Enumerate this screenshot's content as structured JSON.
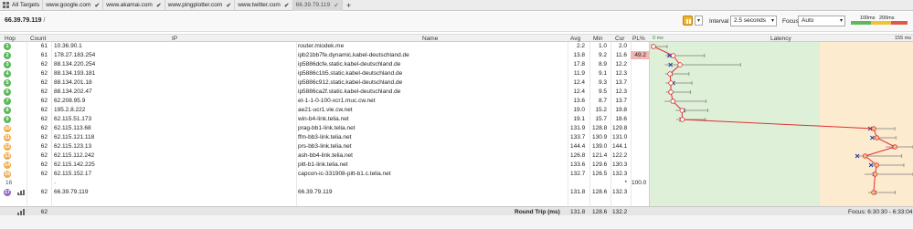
{
  "tabs": [
    {
      "label": "All Targets"
    },
    {
      "label": "www.google.com"
    },
    {
      "label": "www.akamai.com"
    },
    {
      "label": "www.pingplotter.com"
    },
    {
      "label": "www.twitter.com"
    },
    {
      "label": "66.39.79.119"
    }
  ],
  "add_tab_symbol": "+",
  "toolbar": {
    "target": "66.39.79.119",
    "suffix": " /",
    "menu_caret": "▾",
    "interval_label": "Interval",
    "interval_value": "2.5 seconds",
    "focus_label": "Focus",
    "focus_value": "Auto",
    "legend_100": "100ms",
    "legend_200": "200ms"
  },
  "columns": {
    "hop": "Hop",
    "count": "Count",
    "ip": "IP",
    "name": "Name",
    "avg": "Avg",
    "min": "Min",
    "cur": "Cur",
    "pl": "PL%",
    "latency": "Latency"
  },
  "graph": {
    "min_label": "0 ms",
    "max_label": "155 ms",
    "max_ms": 155,
    "colors": {
      "green": "#5cb85c",
      "yellow": "#f0ad4e",
      "line": "#e03030",
      "marker": "#1f3fb0"
    }
  },
  "hops": [
    {
      "hop": "1",
      "count": "61",
      "ip": "10.36.90.1",
      "name": "router.miodek.me",
      "avg": "2.2",
      "min": "1.0",
      "cur": "2.0",
      "pl": "",
      "status": "green"
    },
    {
      "hop": "2",
      "count": "61",
      "ip": "178.27.183.254",
      "name": "ipb21bb7fe.dynamic.kabel-deutschland.de",
      "avg": "13.8",
      "min": "9.2",
      "cur": "11.6",
      "pl": "49.2",
      "status": "green"
    },
    {
      "hop": "3",
      "count": "62",
      "ip": "88.134.220.254",
      "name": "ip5886dcfe.static.kabel-deutschland.de",
      "avg": "17.8",
      "min": "8.9",
      "cur": "12.2",
      "pl": "",
      "status": "green"
    },
    {
      "hop": "4",
      "count": "62",
      "ip": "88.134.193.181",
      "name": "ip5886c1b5.static.kabel-deutschland.de",
      "avg": "11.9",
      "min": "9.1",
      "cur": "12.3",
      "pl": "",
      "status": "green"
    },
    {
      "hop": "5",
      "count": "62",
      "ip": "88.134.201.18",
      "name": "ip5886c912.static.kabel-deutschland.de",
      "avg": "12.4",
      "min": "9.3",
      "cur": "13.7",
      "pl": "",
      "status": "green"
    },
    {
      "hop": "6",
      "count": "62",
      "ip": "88.134.202.47",
      "name": "ip5886ca2f.static.kabel-deutschland.de",
      "avg": "12.4",
      "min": "9.5",
      "cur": "12.3",
      "pl": "",
      "status": "green"
    },
    {
      "hop": "7",
      "count": "62",
      "ip": "62.208.95.9",
      "name": "et-1-1-0-100-xcr1.muc.cw.net",
      "avg": "13.6",
      "min": "8.7",
      "cur": "13.7",
      "pl": "",
      "status": "green"
    },
    {
      "hop": "8",
      "count": "62",
      "ip": "195.2.8.222",
      "name": "ae21-ucr1.vie.cw.net",
      "avg": "19.0",
      "min": "15.2",
      "cur": "19.8",
      "pl": "",
      "status": "green"
    },
    {
      "hop": "9",
      "count": "62",
      "ip": "62.115.51.173",
      "name": "win-b4-link.telia.net",
      "avg": "19.1",
      "min": "15.7",
      "cur": "18.6",
      "pl": "",
      "status": "green"
    },
    {
      "hop": "10",
      "count": "62",
      "ip": "62.115.113.68",
      "name": "prag-bb1-link.telia.net",
      "avg": "131.9",
      "min": "128.8",
      "cur": "129.8",
      "pl": "",
      "status": "yellow"
    },
    {
      "hop": "11",
      "count": "62",
      "ip": "62.115.121.118",
      "name": "ffm-bb3-link.telia.net",
      "avg": "133.7",
      "min": "130.9",
      "cur": "131.0",
      "pl": "",
      "status": "yellow"
    },
    {
      "hop": "12",
      "count": "62",
      "ip": "62.115.123.13",
      "name": "prs-bb3-link.telia.net",
      "avg": "144.4",
      "min": "139.0",
      "cur": "144.1",
      "pl": "",
      "status": "yellow"
    },
    {
      "hop": "13",
      "count": "62",
      "ip": "62.115.112.242",
      "name": "ash-bb4-link.telia.net",
      "avg": "126.8",
      "min": "121.4",
      "cur": "122.2",
      "pl": "",
      "status": "yellow"
    },
    {
      "hop": "14",
      "count": "62",
      "ip": "62.115.142.225",
      "name": "pitt-b1-link.telia.net",
      "avg": "133.6",
      "min": "129.6",
      "cur": "130.3",
      "pl": "",
      "status": "yellow"
    },
    {
      "hop": "15",
      "count": "62",
      "ip": "62.115.152.17",
      "name": "capcon-ic-331908-pitt-b1.c.telia.net",
      "avg": "132.7",
      "min": "126.5",
      "cur": "132.3",
      "pl": "",
      "status": "yellow"
    },
    {
      "hop": "16",
      "count": "",
      "ip": "-",
      "name": "",
      "avg": "",
      "min": "",
      "cur": "*",
      "pl": "100.0",
      "status": "none"
    },
    {
      "hop": "17",
      "count": "62",
      "ip": "66.39.79.119",
      "name": "66.39.79.119",
      "avg": "131.8",
      "min": "128.6",
      "cur": "132.3",
      "pl": "",
      "status": "purple"
    }
  ],
  "summary": {
    "count": "62",
    "label": "Round Trip (ms)",
    "avg": "131.8",
    "min": "128.6",
    "cur": "132.2",
    "focus": "Focus: 6:30:30 - 6:33:04"
  }
}
